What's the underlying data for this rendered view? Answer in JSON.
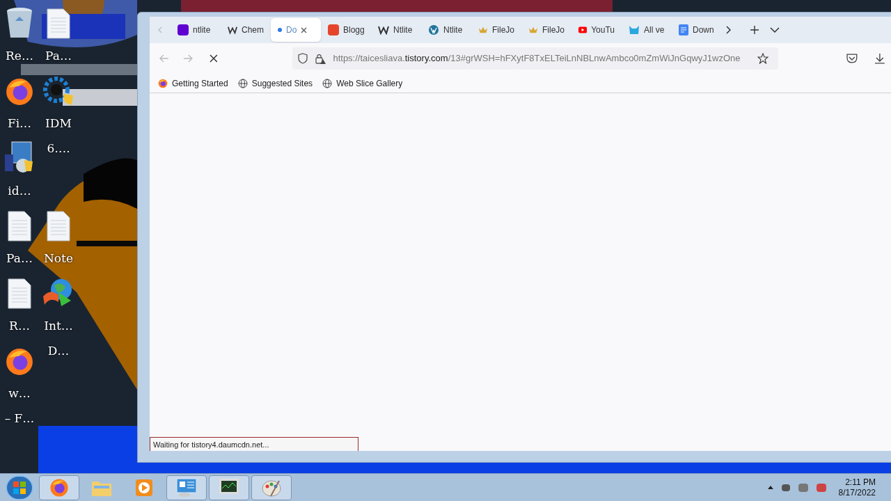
{
  "desktop": {
    "columns": [
      {
        "icons": [
          {
            "label": "Re…",
            "kind": "recycle"
          },
          {
            "label": "Fi…",
            "kind": "firefox"
          },
          {
            "label": "id…",
            "kind": "installer"
          },
          {
            "label": "Pa…",
            "kind": "file"
          },
          {
            "label": "R…",
            "kind": "file"
          },
          {
            "label": "w…",
            "kind": "firefox"
          },
          {
            "label": "– F…",
            "kind": "none"
          }
        ]
      },
      {
        "icons": [
          {
            "label": "Pa…",
            "kind": "file"
          },
          {
            "label": "IDM",
            "kind": "gear"
          },
          {
            "label": "6….",
            "kind": "none"
          },
          {
            "label": "Note",
            "kind": "file"
          },
          {
            "label": "Int…",
            "kind": "globe"
          },
          {
            "label": "D…",
            "kind": "none"
          }
        ]
      }
    ]
  },
  "browser": {
    "tabs": [
      {
        "label": "ntlite",
        "kind": "yahoo",
        "selected": false
      },
      {
        "label": "Chem",
        "kind": "w",
        "selected": false
      },
      {
        "label": "Do",
        "kind": "dot",
        "selected": true
      },
      {
        "label": "Blogg",
        "kind": "blog",
        "selected": false
      },
      {
        "label": "Ntlite",
        "kind": "w",
        "selected": false
      },
      {
        "label": "Ntlite",
        "kind": "wp",
        "selected": false
      },
      {
        "label": "FileJo",
        "kind": "crown",
        "selected": false
      },
      {
        "label": "FileJo",
        "kind": "crown",
        "selected": false
      },
      {
        "label": "YouTu",
        "kind": "youtube",
        "selected": false
      },
      {
        "label": "All ve",
        "kind": "cat",
        "selected": false
      },
      {
        "label": "Down",
        "kind": "doc",
        "selected": false
      }
    ],
    "loading": true,
    "url": "https://taicesliava.**tistory.com**/13#grWSH=hFXytF8TxELTeiLnNBLnwAmbco0mZmWiJnGqwyJ1wzOne",
    "bookmarks": [
      {
        "label": "Getting Started",
        "kind": "firefox"
      },
      {
        "label": "Suggested Sites",
        "kind": "globe"
      },
      {
        "label": "Web Slice Gallery",
        "kind": "globe"
      }
    ],
    "status": "Waiting for tistory4.daumcdn.net..."
  },
  "taskbar": {
    "items": [
      {
        "kind": "firefox",
        "running": true
      },
      {
        "kind": "folder",
        "running": false
      },
      {
        "kind": "media",
        "running": false
      },
      {
        "kind": "panel",
        "running": true
      },
      {
        "kind": "monitor",
        "running": true
      },
      {
        "kind": "paint",
        "running": true
      }
    ],
    "time": "2:11 PM",
    "date": "8/17/2022"
  }
}
